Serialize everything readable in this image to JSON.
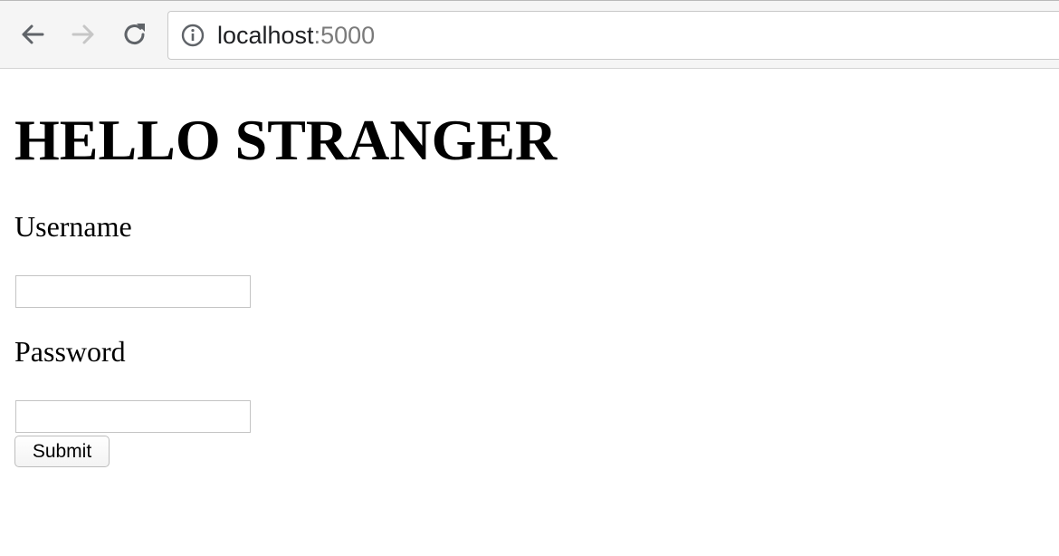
{
  "browser": {
    "url_host": "localhost",
    "url_port": ":5000",
    "back_icon": "arrow-left-icon",
    "forward_icon": "arrow-right-icon",
    "reload_icon": "reload-icon",
    "info_icon": "info-icon"
  },
  "page": {
    "title": "HELLO STRANGER",
    "username_label": "Username",
    "username_value": "",
    "password_label": "Password",
    "password_value": "",
    "submit_label": "Submit"
  }
}
